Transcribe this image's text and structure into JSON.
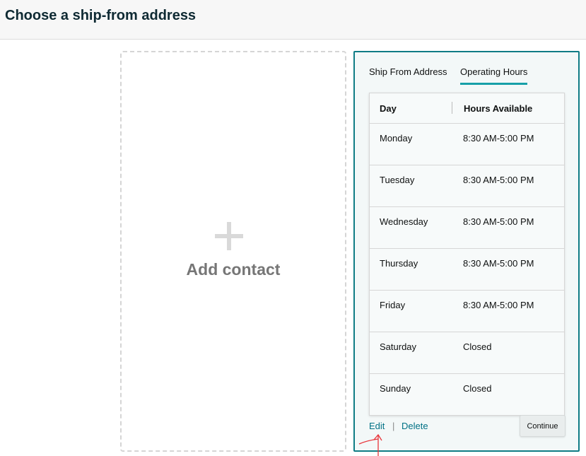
{
  "header": {
    "title": "Choose a ship-from address"
  },
  "add_card": {
    "icon": "plus-icon",
    "label": "Add contact"
  },
  "address_card": {
    "tabs": [
      {
        "label": "Ship From Address",
        "active": false
      },
      {
        "label": "Operating Hours",
        "active": true
      }
    ],
    "table": {
      "headers": {
        "day": "Day",
        "hours": "Hours Available"
      },
      "rows": [
        {
          "day": "Monday",
          "hours": "8:30 AM-5:00 PM"
        },
        {
          "day": "Tuesday",
          "hours": "8:30 AM-5:00 PM"
        },
        {
          "day": "Wednesday",
          "hours": "8:30 AM-5:00 PM"
        },
        {
          "day": "Thursday",
          "hours": "8:30 AM-5:00 PM"
        },
        {
          "day": "Friday",
          "hours": "8:30 AM-5:00 PM"
        },
        {
          "day": "Saturday",
          "hours": "Closed"
        },
        {
          "day": "Sunday",
          "hours": "Closed"
        }
      ]
    },
    "actions": {
      "edit": "Edit",
      "separator": "|",
      "delete": "Delete"
    },
    "continue_label": "Continue"
  },
  "colors": {
    "accent": "#0f7c85",
    "tab_underline": "#17a0a8",
    "link": "#007185",
    "annotation": "#e8343a"
  }
}
